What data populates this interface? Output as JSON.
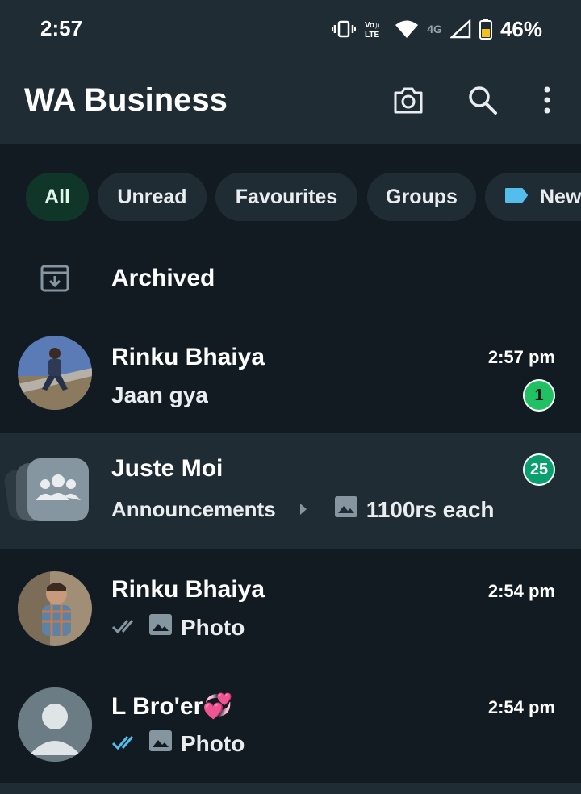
{
  "status_bar": {
    "time": "2:57",
    "volte_label": "Vo\nLTE",
    "network_label": "4G",
    "battery_percent": "46%"
  },
  "app_bar": {
    "title": "WA Business",
    "icons": [
      "camera-icon",
      "search-icon",
      "more-vert-icon"
    ]
  },
  "filters": {
    "chips": [
      "All",
      "Unread",
      "Favourites",
      "Groups",
      "New"
    ],
    "selected": "All",
    "label_color": "#53bdeb"
  },
  "archived": {
    "label": "Archived"
  },
  "chats": [
    {
      "name": "Rinku Bhaiya",
      "time": "2:57 pm",
      "preview": "Jaan gya",
      "unread": "1"
    },
    {
      "name": "Juste Moi",
      "unread": "25",
      "preview_group": "Announcements",
      "preview_text": "1100rs each"
    },
    {
      "name": "Rinku Bhaiya",
      "time": "2:54 pm",
      "preview": "Photo",
      "ticks": "delivered"
    },
    {
      "name": "L Bro'er💞",
      "time": "2:54 pm",
      "preview": "Photo",
      "ticks": "read"
    }
  ],
  "colors": {
    "background": "#121b22",
    "header": "#1f2c34",
    "accent_green": "#21c063",
    "read_tick_blue": "#53bdeb"
  }
}
